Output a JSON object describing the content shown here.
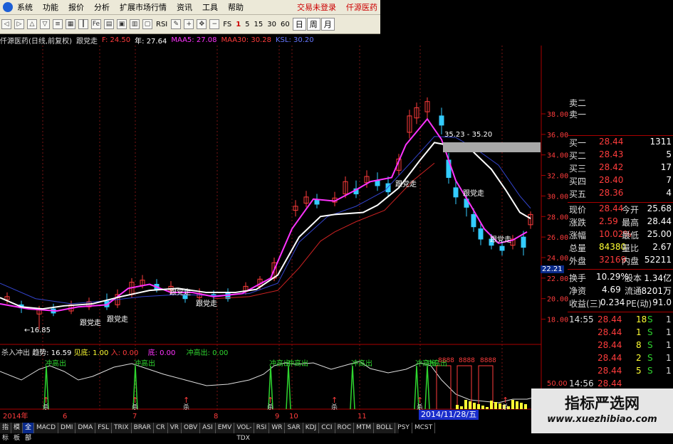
{
  "menu": {
    "items": [
      "系统",
      "功能",
      "报价",
      "分析",
      "扩展市场行情",
      "资讯",
      "工具",
      "帮助"
    ],
    "right": [
      "交易未登录",
      "仟源医药"
    ]
  },
  "toolbar": {
    "rsi_label": "RSI",
    "fs_label": "FS",
    "periods": [
      "1",
      "5",
      "15",
      "30",
      "60"
    ],
    "views": [
      "日",
      "周",
      "月"
    ]
  },
  "info": {
    "title": "仟源医药(日线,前复权)",
    "follow": "跟党走",
    "f_val": "F: 24.50",
    "year_val": "年: 27.64",
    "maa5": "MAA5: 27.08",
    "maa30": "MAA30: 30.28",
    "ksl": "KSL: 30.20"
  },
  "colors": {
    "up": "#ff3c3c",
    "down": "#2fd52f",
    "ma_white": "#ffffff",
    "ma_magenta": "#ff33ff",
    "ma_blue": "#3344cc",
    "ma_red": "#cc2222",
    "grid": "#7a1515"
  },
  "chart_data": {
    "type": "candlestick",
    "ylim": [
      16.0,
      40.0
    ],
    "y_ticks": [
      "38.00",
      "36.00",
      "34.00",
      "32.00",
      "30.00",
      "28.00",
      "26.00",
      "24.00",
      "22.00",
      "20.00",
      "18.00"
    ],
    "x_labels": [
      "2014年",
      "6",
      "7",
      "8",
      "9",
      "10",
      "11"
    ],
    "annotations": {
      "low_label": "←16.85",
      "band_label": "35.23 - 35.20",
      "follow_labels": [
        "跟党走",
        "跟党走",
        "跟党走",
        "跟党走",
        "跟党走",
        "跟党走",
        "跟党走"
      ],
      "cursor_price": "22.21",
      "date_badge": "2014/11/28/五"
    },
    "white_line": [
      [
        0,
        20.1
      ],
      [
        30,
        19.2
      ],
      [
        60,
        19.0
      ],
      [
        90,
        19.3
      ],
      [
        130,
        19.5
      ],
      [
        170,
        20.2
      ],
      [
        210,
        20.8
      ],
      [
        250,
        21.0
      ],
      [
        290,
        20.6
      ],
      [
        330,
        20.6
      ],
      [
        360,
        20.9
      ],
      [
        390,
        22.3
      ],
      [
        420,
        26.0
      ],
      [
        450,
        28.0
      ],
      [
        470,
        28.2
      ],
      [
        490,
        28.3
      ],
      [
        510,
        28.4
      ],
      [
        530,
        29.1
      ],
      [
        560,
        30.8
      ],
      [
        590,
        33.5
      ],
      [
        610,
        35.2
      ],
      [
        640,
        34.8
      ],
      [
        660,
        34.6
      ],
      [
        690,
        32.6
      ],
      [
        710,
        30.6
      ],
      [
        730,
        28.4
      ],
      [
        745,
        27.8
      ]
    ],
    "magenta_line": [
      [
        0,
        19.5
      ],
      [
        40,
        19.0
      ],
      [
        80,
        18.8
      ],
      [
        110,
        19.2
      ],
      [
        150,
        19.4
      ],
      [
        180,
        21.0
      ],
      [
        210,
        21.4
      ],
      [
        240,
        20.6
      ],
      [
        270,
        20.6
      ],
      [
        300,
        20.2
      ],
      [
        340,
        20.5
      ],
      [
        380,
        22.0
      ],
      [
        410,
        26.8
      ],
      [
        440,
        29.7
      ],
      [
        470,
        29.5
      ],
      [
        500,
        30.6
      ],
      [
        520,
        31.4
      ],
      [
        550,
        31.8
      ],
      [
        570,
        35.0
      ],
      [
        600,
        37.5
      ],
      [
        620,
        35.5
      ],
      [
        640,
        31.5
      ],
      [
        660,
        29.2
      ],
      [
        680,
        26.8
      ],
      [
        700,
        25.4
      ],
      [
        720,
        25.7
      ],
      [
        740,
        26.5
      ]
    ],
    "blue_line": [
      [
        0,
        21.5
      ],
      [
        50,
        20.0
      ],
      [
        100,
        19.5
      ],
      [
        150,
        19.8
      ],
      [
        200,
        20.2
      ],
      [
        250,
        20.4
      ],
      [
        300,
        20.3
      ],
      [
        350,
        20.5
      ],
      [
        390,
        21.5
      ],
      [
        420,
        25.5
      ],
      [
        460,
        28.0
      ],
      [
        500,
        29.0
      ],
      [
        540,
        30.5
      ],
      [
        580,
        33.5
      ],
      [
        610,
        35.8
      ],
      [
        640,
        35.7
      ],
      [
        670,
        34.5
      ],
      [
        700,
        33.0
      ],
      [
        730,
        30.0
      ],
      [
        745,
        28.8
      ]
    ],
    "red_line": [
      [
        300,
        20.0
      ],
      [
        350,
        20.2
      ],
      [
        390,
        20.8
      ],
      [
        420,
        23.0
      ],
      [
        450,
        25.6
      ],
      [
        470,
        26.5
      ],
      [
        500,
        27.5
      ],
      [
        540,
        28.6
      ],
      [
        580,
        31.5
      ],
      [
        610,
        33.2
      ]
    ],
    "candles": [
      [
        10,
        19.9,
        20.2,
        20.6,
        19.5
      ],
      [
        30,
        19.4,
        19.1,
        19.8,
        18.6
      ],
      [
        55,
        18.5,
        18.9,
        19.3,
        17.0
      ],
      [
        75,
        19.0,
        18.6,
        19.5,
        18.3
      ],
      [
        100,
        18.8,
        19.4,
        19.8,
        18.5
      ],
      [
        125,
        19.2,
        19.7,
        20.1,
        18.9
      ],
      [
        150,
        19.8,
        19.2,
        20.5,
        18.9
      ],
      [
        165,
        19.4,
        20.4,
        20.9,
        19.1
      ],
      [
        185,
        20.4,
        21.6,
        22.0,
        20.1
      ],
      [
        200,
        21.3,
        21.8,
        22.3,
        21.0
      ],
      [
        220,
        21.4,
        20.9,
        21.9,
        20.6
      ],
      [
        240,
        20.8,
        21.2,
        21.7,
        20.4
      ],
      [
        260,
        20.3,
        20.0,
        20.9,
        19.6
      ],
      [
        280,
        20.1,
        20.5,
        21.0,
        19.8
      ],
      [
        300,
        20.4,
        20.3,
        20.8,
        19.9
      ],
      [
        320,
        20.6,
        20.0,
        21.0,
        19.7
      ],
      [
        345,
        20.7,
        21.2,
        21.6,
        20.4
      ],
      [
        365,
        21.2,
        21.9,
        22.2,
        20.9
      ],
      [
        385,
        22.0,
        23.5,
        24.0,
        21.7
      ],
      [
        415,
        28.6,
        29.0,
        29.6,
        28.0
      ],
      [
        430,
        29.3,
        29.9,
        30.5,
        28.9
      ],
      [
        445,
        29.6,
        29.2,
        30.2,
        28.8
      ],
      [
        470,
        29.4,
        29.8,
        30.4,
        29.0
      ],
      [
        485,
        30.2,
        31.4,
        31.9,
        29.8
      ],
      [
        500,
        30.7,
        30.2,
        31.5,
        29.8
      ],
      [
        515,
        31.3,
        31.9,
        32.5,
        30.8
      ],
      [
        530,
        31.5,
        31.0,
        32.3,
        30.5
      ],
      [
        545,
        31.2,
        30.4,
        31.9,
        29.9
      ],
      [
        560,
        32.5,
        33.6,
        34.1,
        32.0
      ],
      [
        575,
        36.2,
        37.8,
        38.4,
        35.6
      ],
      [
        585,
        37.6,
        38.6,
        39.1,
        37.0
      ],
      [
        600,
        38.2,
        39.2,
        39.6,
        37.5
      ],
      [
        620,
        37.8,
        36.9,
        38.6,
        36.0
      ],
      [
        630,
        33.5,
        31.8,
        34.2,
        31.2
      ],
      [
        640,
        30.8,
        29.9,
        31.5,
        29.2
      ],
      [
        655,
        29.7,
        28.9,
        30.2,
        28.0
      ],
      [
        665,
        28.2,
        27.0,
        28.8,
        26.5
      ],
      [
        675,
        26.8,
        25.8,
        27.4,
        25.2
      ],
      [
        690,
        25.8,
        25.2,
        26.3,
        24.8
      ],
      [
        705,
        25.1,
        24.7,
        25.6,
        24.2
      ],
      [
        720,
        25.2,
        25.8,
        26.2,
        24.8
      ],
      [
        735,
        26.0,
        25.0,
        26.6,
        24.2
      ],
      [
        745,
        27.2,
        28.2,
        28.5,
        26.8
      ]
    ],
    "indicator": {
      "title": "杀入冲出",
      "trend": "趋势: 16.59",
      "view": "见底: 1.00",
      "enter": "入: 0.00",
      "bottom": "底: 0.00",
      "out": "冲高出: 0.00",
      "labels": [
        "冲高出",
        "冲高出",
        "冲高出",
        "冲高出",
        "冲高出",
        "冲高出",
        "冲高出"
      ],
      "enter_labels": [
        "杀",
        "杀",
        "杀",
        "杀",
        "杀",
        "杀",
        "杀"
      ],
      "red_labels": [
        "8888",
        "8888",
        "8888"
      ],
      "axis": [
        "50.00",
        "0.00"
      ]
    }
  },
  "quote": {
    "sells": [
      [
        "卖二",
        "",
        ""
      ],
      [
        "卖一",
        "",
        ""
      ]
    ],
    "buys": [
      [
        "买一",
        "28.44",
        "1311"
      ],
      [
        "买二",
        "28.43",
        "5"
      ],
      [
        "买三",
        "28.42",
        "17"
      ],
      [
        "买四",
        "28.40",
        "7"
      ],
      [
        "买五",
        "28.36",
        "4"
      ]
    ],
    "stats": [
      {
        "l": "现价",
        "v": "28.44",
        "l2": "今开",
        "v2": "25.68"
      },
      {
        "l": "涨跌",
        "v": "2.59",
        "l2": "最高",
        "v2": "28.44"
      },
      {
        "l": "涨幅",
        "v": "10.02%",
        "l2": "最低",
        "v2": "25.00"
      },
      {
        "l": "总量",
        "v": "84380",
        "l2": "量比",
        "v2": "2.67"
      },
      {
        "l": "外盘",
        "v": "32169",
        "l2": "内盘",
        "v2": "52211"
      }
    ],
    "fund": [
      {
        "l": "换手",
        "v": "10.29%",
        "l2": "股本",
        "v2": "1.34亿"
      },
      {
        "l": "净资",
        "v": "4.69",
        "l2": "流通",
        "v2": "8201万"
      },
      {
        "l": "收益(三)",
        "v": "0.234",
        "l2": "PE(动)",
        "v2": "91.0"
      }
    ],
    "ticks": [
      {
        "t": "14:55",
        "p": "28.44",
        "n": "18",
        "s": "S",
        "r": "1"
      },
      {
        "t": "",
        "p": "28.44",
        "n": "1",
        "s": "S",
        "r": "1"
      },
      {
        "t": "",
        "p": "28.44",
        "n": "8",
        "s": "S",
        "r": "1"
      },
      {
        "t": "",
        "p": "28.44",
        "n": "2",
        "s": "S",
        "r": "1"
      },
      {
        "t": "",
        "p": "28.44",
        "n": "5",
        "s": "S",
        "r": "1"
      },
      {
        "t": "14:56",
        "p": "28.44",
        "n": "",
        "s": "",
        "r": ""
      }
    ]
  },
  "tabs": [
    "指标",
    "模板",
    "全部",
    "MACD",
    "DMI",
    "DMA",
    "FSL",
    "TRIX",
    "BRAR",
    "CR",
    "VR",
    "OBV",
    "ASI",
    "EMV",
    "VOL-TDX",
    "RSI",
    "WR",
    "SAR",
    "KDJ",
    "CCI",
    "ROC",
    "MTM",
    "BOLL",
    "PSY",
    "MCST"
  ],
  "watermark": {
    "title": "指标严选网",
    "url": "www.xuezhibiao.com"
  }
}
